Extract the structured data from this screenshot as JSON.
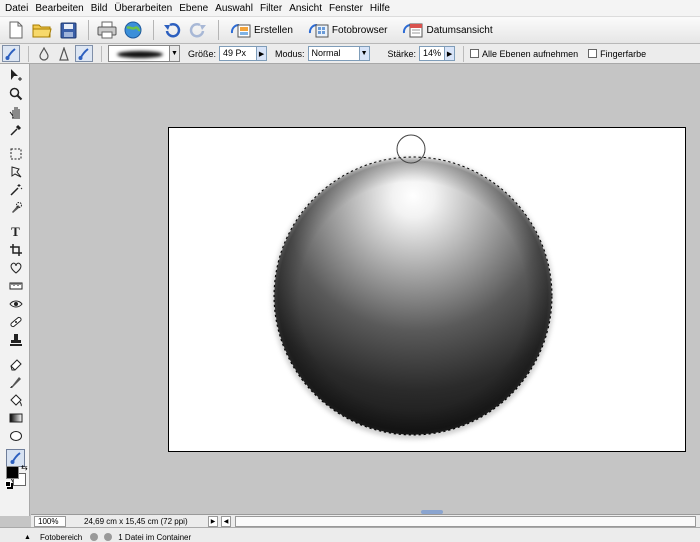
{
  "menu": [
    "Datei",
    "Bearbeiten",
    "Bild",
    "Überarbeiten",
    "Ebene",
    "Auswahl",
    "Filter",
    "Ansicht",
    "Fenster",
    "Hilfe"
  ],
  "shortcuts": {
    "create_label": "Erstellen",
    "photobrowser_label": "Fotobrowser",
    "dateview_label": "Datumsansicht"
  },
  "options": {
    "size_label": "Größe:",
    "size_value": "49 Px",
    "mode_label": "Modus:",
    "mode_value": "Normal",
    "strength_label": "Stärke:",
    "strength_value": "14%",
    "all_layers_label": "Alle Ebenen aufnehmen",
    "finger_paint_label": "Fingerfarbe"
  },
  "statusbar": {
    "zoom": "100%",
    "doc_info": "24,69 cm x 15,45 cm (72 ppi)"
  },
  "bin": {
    "label": "Fotobereich",
    "count": "1 Datei im Container"
  },
  "colors": {
    "foreground": "#000000",
    "background": "#ffffff",
    "accent": "#2c6bd4"
  }
}
